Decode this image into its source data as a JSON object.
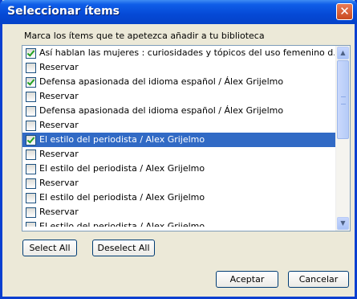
{
  "window": {
    "title": "Seleccionar ítems",
    "close_symbol": "✕"
  },
  "instructions": "Marca los ítems que te apetezca añadir a tu biblioteca",
  "items": [
    {
      "label": "Así hablan las mujeres : curiosidades y tópicos del uso femenino d...",
      "checked": true,
      "selected": false
    },
    {
      "label": "Reservar",
      "checked": false,
      "selected": false
    },
    {
      "label": "Defensa apasionada del idioma español / Álex Grijelmo",
      "checked": true,
      "selected": false
    },
    {
      "label": "Reservar",
      "checked": false,
      "selected": false
    },
    {
      "label": "Defensa apasionada del idioma español / Álex Grijelmo",
      "checked": false,
      "selected": false
    },
    {
      "label": "Reservar",
      "checked": false,
      "selected": false
    },
    {
      "label": "El estilo del periodista / Alex Grijelmo",
      "checked": true,
      "selected": true
    },
    {
      "label": "Reservar",
      "checked": false,
      "selected": false
    },
    {
      "label": "El estilo del periodista / Alex Grijelmo",
      "checked": false,
      "selected": false
    },
    {
      "label": "Reservar",
      "checked": false,
      "selected": false
    },
    {
      "label": "El estilo del periodista / Alex Grijelmo",
      "checked": false,
      "selected": false
    },
    {
      "label": "Reservar",
      "checked": false,
      "selected": false
    },
    {
      "label": "El estilo del periodista / Alex Grijelmo",
      "checked": false,
      "selected": false
    }
  ],
  "buttons": {
    "select_all": "Select All",
    "deselect_all": "Deselect All",
    "ok": "Aceptar",
    "cancel": "Cancelar"
  },
  "icons": {
    "scroll_up": "chevron-up-icon",
    "scroll_down": "chevron-down-icon",
    "close": "close-icon"
  },
  "colors": {
    "titlebar": "#0549d6",
    "selection": "#316ac5",
    "check": "#21a121",
    "close": "#c94a1f"
  }
}
